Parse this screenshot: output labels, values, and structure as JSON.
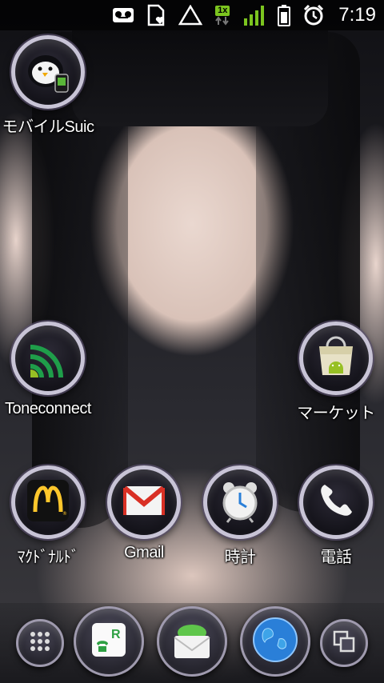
{
  "status_bar": {
    "network_badge": "1x",
    "time": "7:19",
    "icons": [
      "voicemail-icon",
      "heart-sim-icon",
      "warning-triangle-icon",
      "data-transfer-icon",
      "signal-bars-icon",
      "battery-icon",
      "alarm-clock-icon"
    ]
  },
  "home": {
    "apps": [
      {
        "name": "mobile-suica",
        "label": "モバイルSuic",
        "icon": "penguin-icon"
      },
      {
        "name": "toneconnect",
        "label": "Toneconnect",
        "icon": "toneconnect-waves-icon"
      },
      {
        "name": "market",
        "label": "マーケット",
        "icon": "android-market-bag-icon"
      },
      {
        "name": "mcdonalds",
        "label": "ﾏｸﾄﾞﾅﾙﾄﾞ",
        "icon": "mcdonalds-arches-icon"
      },
      {
        "name": "gmail",
        "label": "Gmail",
        "icon": "gmail-envelope-icon"
      },
      {
        "name": "clock",
        "label": "時計",
        "icon": "alarm-clock-icon"
      },
      {
        "name": "phone",
        "label": "電話",
        "icon": "phone-handset-icon"
      }
    ]
  },
  "dock": {
    "items": [
      "app-drawer-icon",
      "rakuten-phone-icon",
      "messaging-envelope-icon",
      "browser-globe-icon",
      "recent-apps-icon"
    ]
  },
  "colors": {
    "mcdonalds_red": "#d71920",
    "mcdonalds_yellow": "#ffc72c",
    "toneconnect_green": "#1f9e4a",
    "android_green": "#97c024",
    "globe_blue": "#2a7fd8"
  }
}
